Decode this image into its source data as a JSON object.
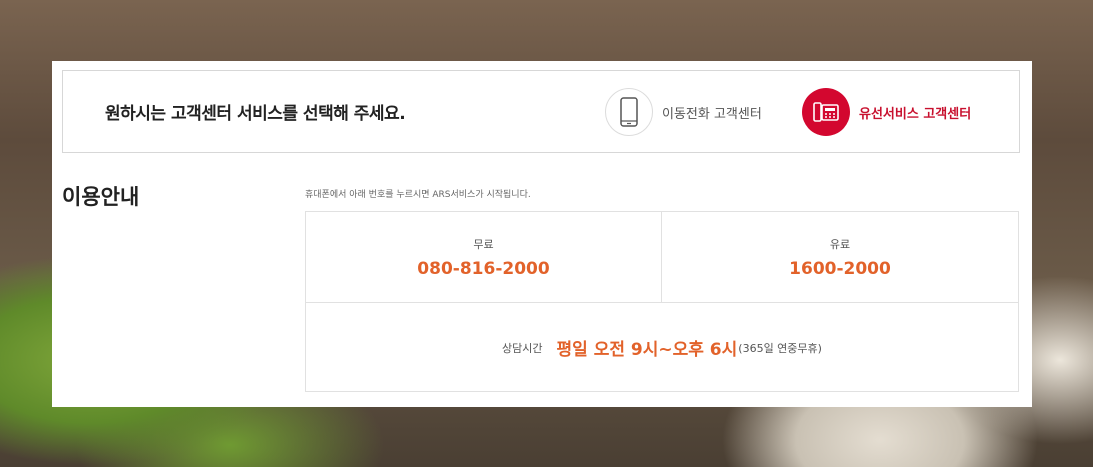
{
  "header": {
    "title": "원하시는 고객센터 서비스를 선택해 주세요.",
    "services": [
      {
        "label": "이동전화 고객센터",
        "icon": "mobile-phone-icon",
        "active": false
      },
      {
        "label": "유선서비스 고객센터",
        "icon": "desk-phone-icon",
        "active": true
      }
    ]
  },
  "info": {
    "title": "이용안내",
    "notice": "휴대폰에서 아래 번호를 누르시면 ARS서비스가 시작됩니다.",
    "free": {
      "label": "무료",
      "number": "080-816-2000"
    },
    "paid": {
      "label": "유료",
      "number": "1600-2000"
    },
    "hours": {
      "label": "상담시간",
      "value": "평일 오전 9시~오후 6시",
      "note": "(365일 연중무휴)"
    }
  },
  "colors": {
    "accent_red": "#d3072f",
    "accent_orange": "#e2622a"
  }
}
